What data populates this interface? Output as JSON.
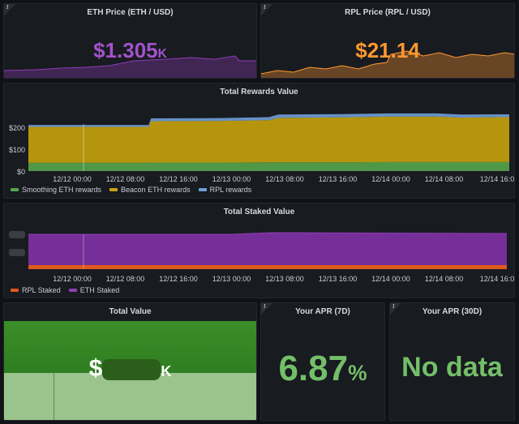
{
  "colors": {
    "eth": "#8f3bb8",
    "rpl": "#ff9830",
    "smoothing": "#56a64b",
    "beacon": "#c8a30c",
    "rplRewards": "#6f9fd8",
    "rplStaked": "#e0581e",
    "ethStaked": "#7b30a0",
    "green": "#73bf69"
  },
  "eth_price": {
    "title": "ETH Price (ETH / USD)",
    "value": "$1.305",
    "unit": "K"
  },
  "rpl_price": {
    "title": "RPL Price (RPL / USD)",
    "value": "$21.14",
    "unit": ""
  },
  "rewards": {
    "title": "Total Rewards Value",
    "y_ticks": [
      "$200",
      "$100",
      "$0"
    ],
    "x_ticks": [
      "12/12 00:00",
      "12/12 08:00",
      "12/12 16:00",
      "12/13 00:00",
      "12/13 08:00",
      "12/13 16:00",
      "12/14 00:00",
      "12/14 08:00",
      "12/14 16:0"
    ],
    "legend": [
      "Smoothing ETH rewards",
      "Beacon ETH rewards",
      "RPL rewards"
    ]
  },
  "staked": {
    "title": "Total Staked Value",
    "x_ticks": [
      "12/12 00:00",
      "12/12 08:00",
      "12/12 16:00",
      "12/13 00:00",
      "12/13 08:00",
      "12/13 16:00",
      "12/14 00:00",
      "12/14 08:00",
      "12/14 16:0"
    ],
    "legend": [
      "RPL Staked",
      "ETH Staked"
    ]
  },
  "total_value": {
    "title": "Total Value",
    "prefix": "$",
    "unit": "K"
  },
  "apr7": {
    "title": "Your APR (7D)",
    "value": "6.87",
    "unit": "%"
  },
  "apr30": {
    "title": "Your APR (30D)",
    "value": "No data"
  },
  "chart_data": [
    {
      "type": "area",
      "title": "Total Rewards Value",
      "x": [
        "12/11 20:00",
        "12/12 00:00",
        "12/12 00:30",
        "12/12 08:00",
        "12/12 09:00",
        "12/12 16:00",
        "12/13 00:00",
        "12/13 08:00",
        "12/13 16:00",
        "12/14 00:00",
        "12/14 08:00",
        "12/14 10:00",
        "12/14 16:00",
        "12/14 17:00"
      ],
      "series": [
        {
          "name": "Smoothing ETH rewards",
          "values": [
            35,
            35,
            35,
            35,
            36,
            36,
            37,
            37,
            37,
            38,
            38,
            38,
            38,
            38
          ]
        },
        {
          "name": "Beacon ETH rewards",
          "values": [
            152,
            152,
            152,
            152,
            175,
            176,
            178,
            188,
            190,
            192,
            192,
            188,
            190,
            190
          ]
        },
        {
          "name": "RPL rewards",
          "values": [
            8,
            8,
            8,
            8,
            12,
            12,
            13,
            14,
            14,
            14,
            14,
            13,
            12,
            12
          ]
        }
      ],
      "ylim": [
        0,
        240
      ]
    }
  ]
}
